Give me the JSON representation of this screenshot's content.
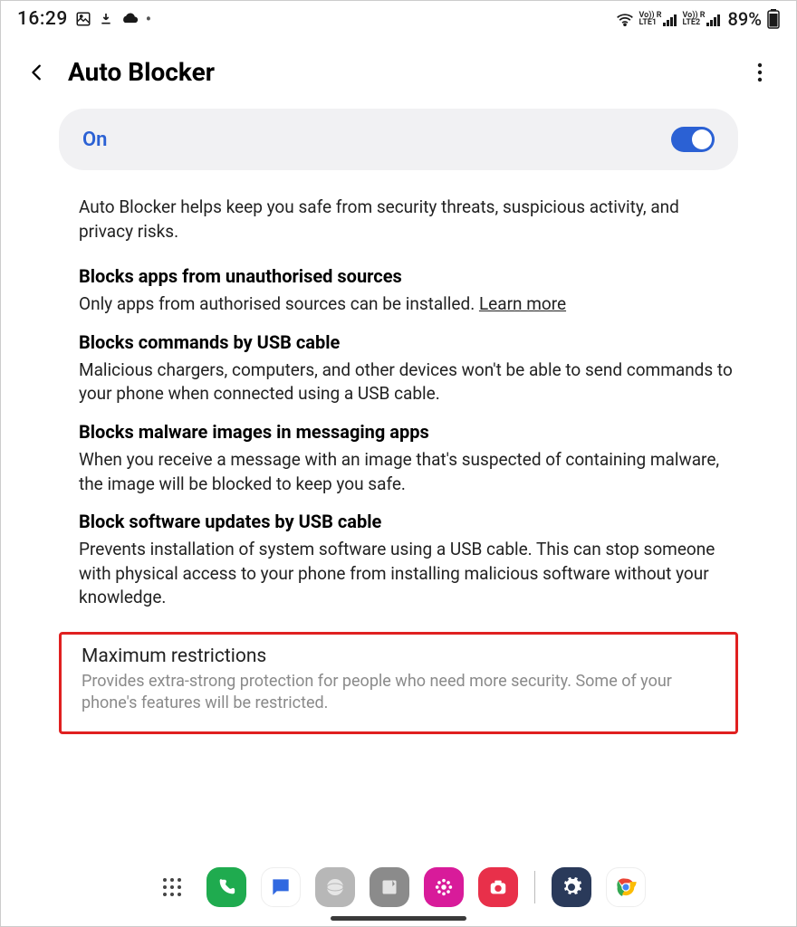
{
  "status": {
    "time": "16:29",
    "battery": "89%",
    "lte1": "VoLTE1",
    "lte2": "VoLTE2"
  },
  "header": {
    "title": "Auto Blocker"
  },
  "toggle": {
    "label": "On"
  },
  "intro": "Auto Blocker helps keep you safe from security threats, suspicious activity, and privacy risks.",
  "sections": [
    {
      "title": "Blocks apps from unauthorised sources",
      "body": "Only apps from authorised sources can be installed. ",
      "link": "Learn more"
    },
    {
      "title": "Blocks commands by USB cable",
      "body": "Malicious chargers, computers, and other devices won't be able to send commands to your phone when connected using a USB cable."
    },
    {
      "title": "Blocks malware images in messaging apps",
      "body": "When you receive a message with an image that's suspected of containing malware, the image will be blocked to keep you safe."
    },
    {
      "title": "Block software updates by USB cable",
      "body": "Prevents installation of system software using a USB cable. This can stop someone with physical access to your phone from installing malicious software without your knowledge."
    }
  ],
  "max": {
    "title": "Maximum restrictions",
    "body": "Provides extra-strong protection for people who need more security. Some of your phone's features will be restricted."
  }
}
